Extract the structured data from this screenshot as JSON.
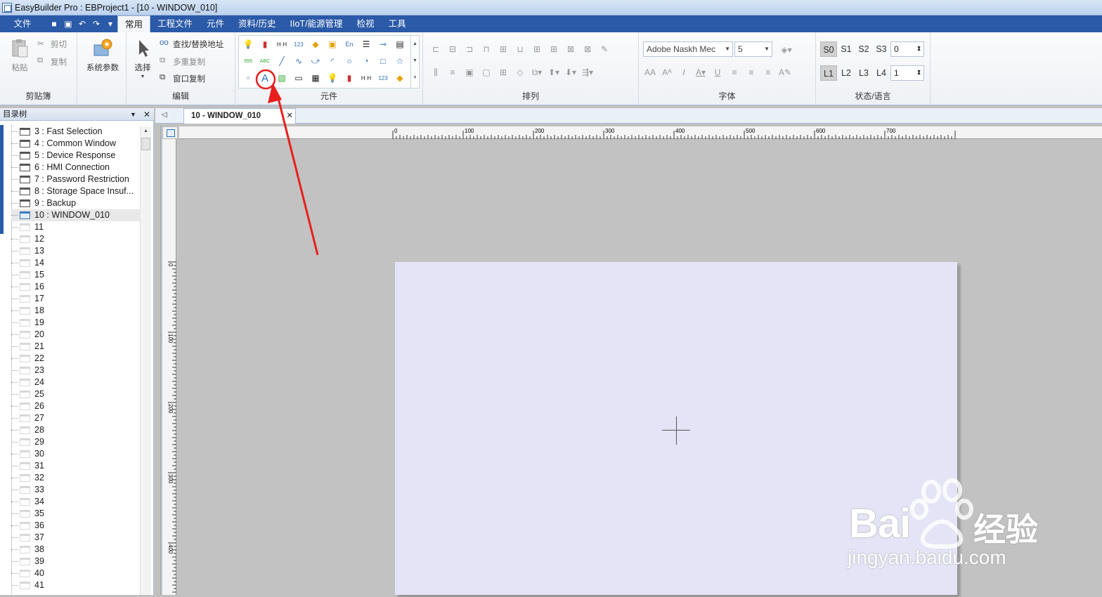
{
  "window": {
    "title": "EasyBuilder Pro : EBProject1 - [10 - WINDOW_010]"
  },
  "menu": {
    "file": "文件",
    "tabs": [
      "常用",
      "工程文件",
      "元件",
      "资料/历史",
      "IIoT/能源管理",
      "检视",
      "工具"
    ]
  },
  "ribbon": {
    "clipboard": {
      "label": "剪贴簿",
      "paste": "粘贴",
      "cut": "剪切",
      "copy": "复制",
      "sysparam": "系统参数"
    },
    "edit": {
      "label": "编辑",
      "select": "选择",
      "find_replace": "查找/替换地址",
      "multi_copy": "多重复制",
      "window_copy": "窗口复制"
    },
    "objects": {
      "label": "元件"
    },
    "arrange": {
      "label": "排列"
    },
    "font": {
      "label": "字体",
      "family": "Adobe Naskh Mec",
      "size": "5"
    },
    "state": {
      "label": "状态/语言",
      "states": [
        "S0",
        "S1",
        "S2",
        "S3"
      ],
      "state_value": "0",
      "langs": [
        "L1",
        "L2",
        "L3",
        "L4"
      ],
      "lang_value": "1"
    }
  },
  "panel": {
    "title": "目录树"
  },
  "tree": [
    {
      "label": "3 : Fast Selection",
      "type": "win"
    },
    {
      "label": "4 : Common Window",
      "type": "win"
    },
    {
      "label": "5 : Device Response",
      "type": "win"
    },
    {
      "label": "6 : HMI Connection",
      "type": "win"
    },
    {
      "label": "7 : Password Restriction",
      "type": "win"
    },
    {
      "label": "8 : Storage Space Insuf...",
      "type": "win"
    },
    {
      "label": "9 : Backup",
      "type": "win"
    },
    {
      "label": "10 : WINDOW_010",
      "type": "blue"
    },
    {
      "label": "11",
      "type": "empty"
    },
    {
      "label": "12",
      "type": "empty"
    },
    {
      "label": "13",
      "type": "empty"
    },
    {
      "label": "14",
      "type": "empty"
    },
    {
      "label": "15",
      "type": "empty"
    },
    {
      "label": "16",
      "type": "empty"
    },
    {
      "label": "17",
      "type": "empty"
    },
    {
      "label": "18",
      "type": "empty"
    },
    {
      "label": "19",
      "type": "empty"
    },
    {
      "label": "20",
      "type": "empty"
    },
    {
      "label": "21",
      "type": "empty"
    },
    {
      "label": "22",
      "type": "empty"
    },
    {
      "label": "23",
      "type": "empty"
    },
    {
      "label": "24",
      "type": "empty"
    },
    {
      "label": "25",
      "type": "empty"
    },
    {
      "label": "26",
      "type": "empty"
    },
    {
      "label": "27",
      "type": "empty"
    },
    {
      "label": "28",
      "type": "empty"
    },
    {
      "label": "29",
      "type": "empty"
    },
    {
      "label": "30",
      "type": "empty"
    },
    {
      "label": "31",
      "type": "empty"
    },
    {
      "label": "32",
      "type": "empty"
    },
    {
      "label": "33",
      "type": "empty"
    },
    {
      "label": "34",
      "type": "empty"
    },
    {
      "label": "35",
      "type": "empty"
    },
    {
      "label": "36",
      "type": "empty"
    },
    {
      "label": "37",
      "type": "empty"
    },
    {
      "label": "38",
      "type": "empty"
    },
    {
      "label": "39",
      "type": "empty"
    },
    {
      "label": "40",
      "type": "empty"
    },
    {
      "label": "41",
      "type": "empty"
    }
  ],
  "doc_tab": {
    "label": "10 - WINDOW_010"
  },
  "ruler": {
    "h_labels": [
      "0",
      "100",
      "200",
      "300",
      "400",
      "500",
      "600",
      "700"
    ],
    "v_labels": [
      "0",
      "100",
      "200",
      "300",
      "400"
    ]
  },
  "watermark": {
    "brand": "Bai",
    "brand_cn": "经验",
    "url": "jingyan.baidu.com"
  },
  "colors": {
    "accent": "#2a5aa8",
    "canvas": "#e4e4f6",
    "annotation": "#e8201c"
  }
}
